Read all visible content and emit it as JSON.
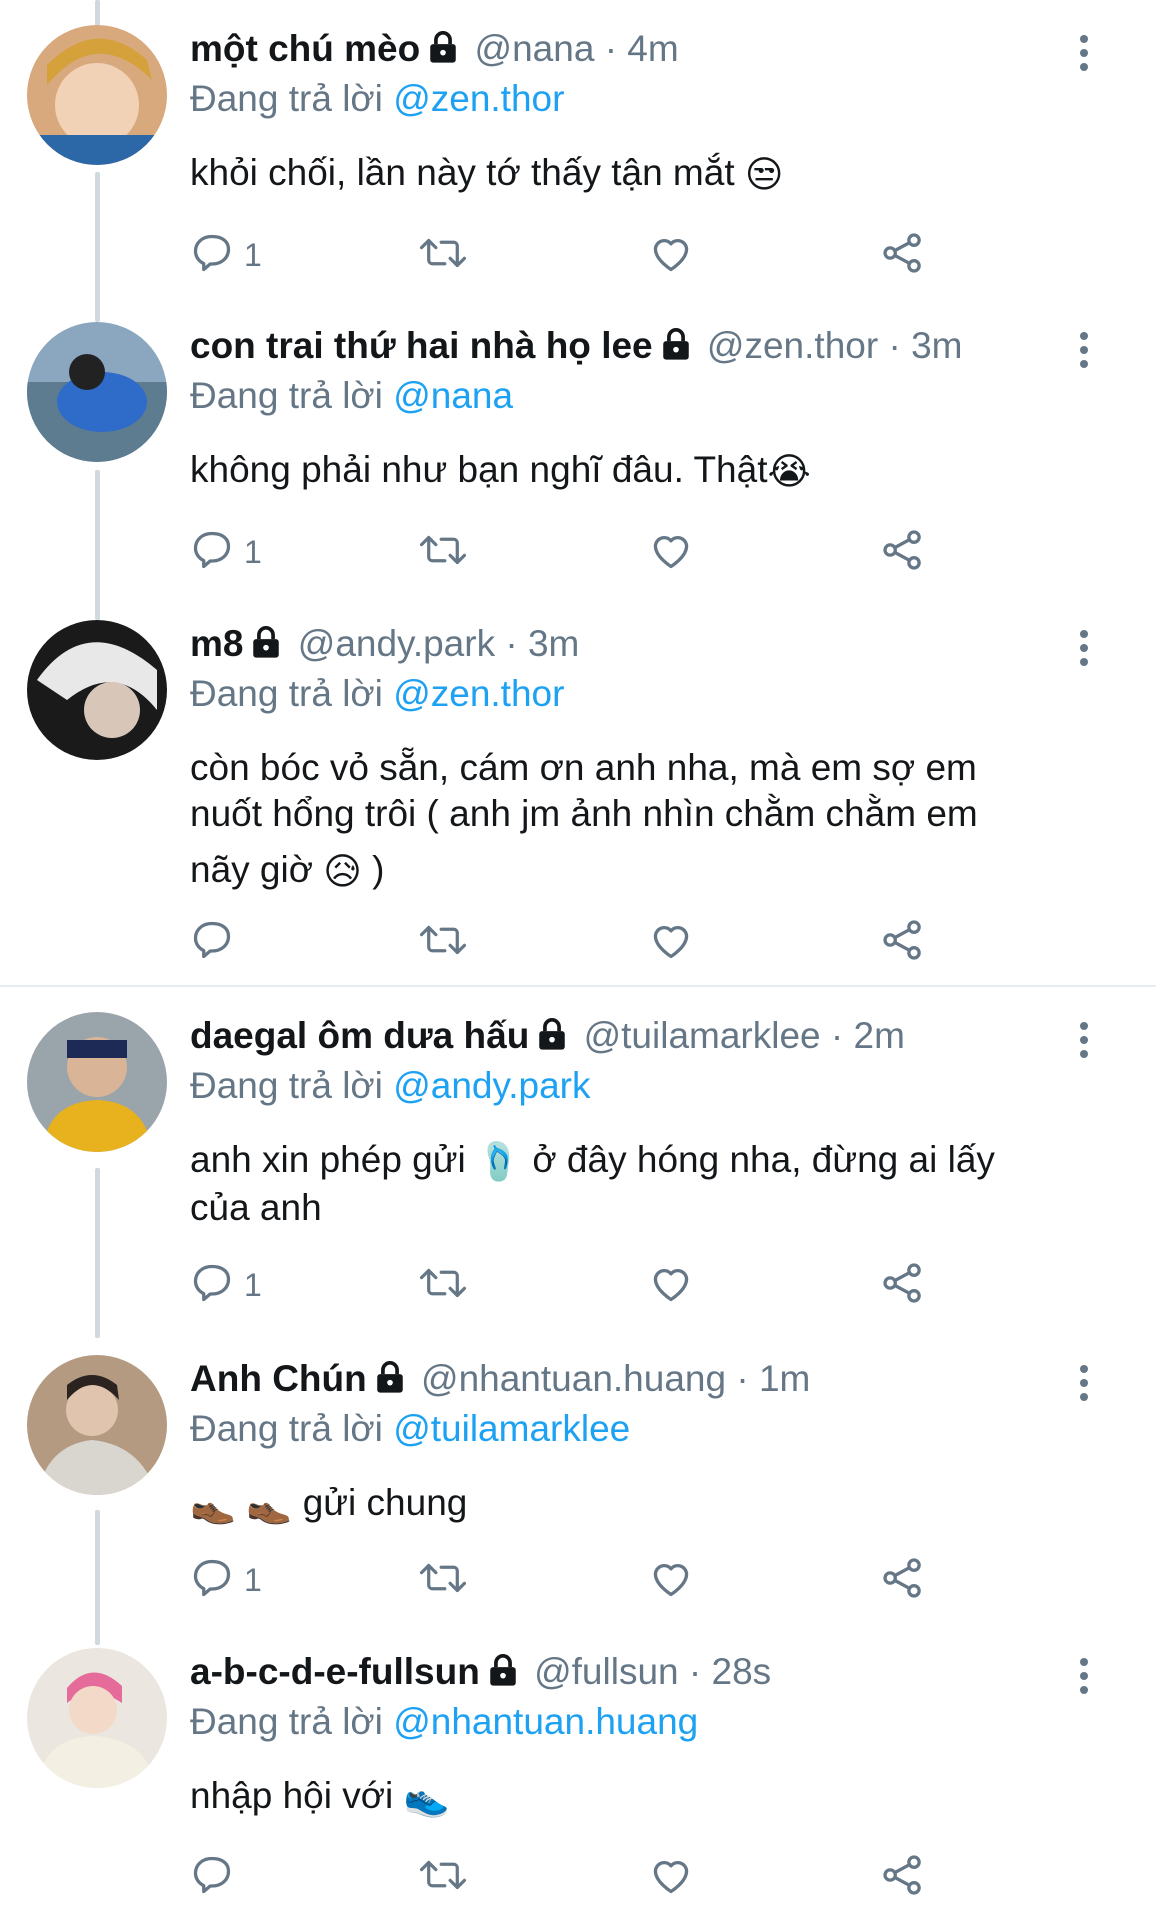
{
  "tweets": [
    {
      "name": "một chú mèo",
      "handle": "@nana",
      "time": "4m",
      "reply_prefix": "Đang trả lời",
      "reply_to": "@zen.thor",
      "text": "khỏi chối, lần này tớ thấy tận mắt",
      "emoji": "😒",
      "reply_count": "1"
    },
    {
      "name": "con trai thứ hai nhà họ lee",
      "handle": "@zen.thor",
      "time": "3m",
      "reply_prefix": "Đang trả lời",
      "reply_to": "@nana",
      "text": "không phải như bạn nghĩ đâu. Thật",
      "emoji": "😭",
      "reply_count": "1"
    },
    {
      "name": "m8",
      "handle": "@andy.park",
      "time": "3m",
      "reply_prefix": "Đang trả lời",
      "reply_to": "@zen.thor",
      "text_lines": [
        "còn bóc vỏ sẵn, cám ơn anh nha, mà em sợ em",
        "nuốt hổng trôi ( anh jm ảnh nhìn chằm chằm em",
        "nãy giờ"
      ],
      "text_end": ")",
      "emoji": "😥",
      "reply_count": ""
    },
    {
      "name": "daegal ôm dưa hấu",
      "handle": "@tuilamarklee",
      "time": "2m",
      "reply_prefix": "Đang trả lời",
      "reply_to": "@andy.park",
      "text_start": "anh xin phép gửi",
      "emoji": "🩴",
      "text_end": "ở đây hóng nha, đừng ai lấy",
      "text_line2": "của anh",
      "reply_count": "1"
    },
    {
      "name": "Anh Chún",
      "handle": "@nhantuan.huang",
      "time": "1m",
      "reply_prefix": "Đang trả lời",
      "reply_to": "@tuilamarklee",
      "emoji": "👞 👞",
      "text": "gửi chung",
      "reply_count": "1"
    },
    {
      "name": "a-b-c-d-e-fullsun",
      "handle": "@fullsun",
      "time": "28s",
      "reply_prefix": "Đang trả lời",
      "reply_to": "@nhantuan.huang",
      "text": "nhập hội với",
      "emoji": "👟",
      "reply_count": ""
    }
  ],
  "separator": "·",
  "colors": {
    "text": "#14171a",
    "secondary": "#657786",
    "link": "#1da1f2",
    "thread_line": "#cfd9de"
  },
  "icons": [
    "lock-icon",
    "reply-icon",
    "retweet-icon",
    "like-icon",
    "share-icon",
    "more-icon"
  ]
}
